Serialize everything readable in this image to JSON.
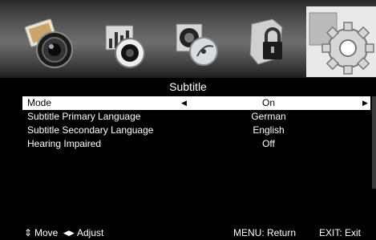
{
  "menu": {
    "tabs": [
      {
        "name": "picture",
        "icon": "camera-lens-photo-icon",
        "selected": false
      },
      {
        "name": "sound",
        "icon": "speaker-equalizer-icon",
        "selected": false
      },
      {
        "name": "channel",
        "icon": "satellite-dish-icon",
        "selected": false
      },
      {
        "name": "lock",
        "icon": "padlock-shield-icon",
        "selected": false
      },
      {
        "name": "setup",
        "icon": "gear-icon",
        "selected": true
      }
    ],
    "title": "Subtitle"
  },
  "settings": [
    {
      "label": "Mode",
      "value": "On",
      "selected": true
    },
    {
      "label": "Subtitle Primary Language",
      "value": "German",
      "selected": false
    },
    {
      "label": "Subtitle Secondary Language",
      "value": "English",
      "selected": false
    },
    {
      "label": "Hearing Impaired",
      "value": "Off",
      "selected": false
    }
  ],
  "footer": {
    "move_icon": "up-down-arrows-icon",
    "move": "Move",
    "adjust_icon": "left-right-arrows-icon",
    "adjust": "Adjust",
    "menu_hint": "MENU: Return",
    "exit_hint": "EXIT: Exit"
  },
  "colors": {
    "selected_row": "#ffffff",
    "background": "#000000"
  }
}
